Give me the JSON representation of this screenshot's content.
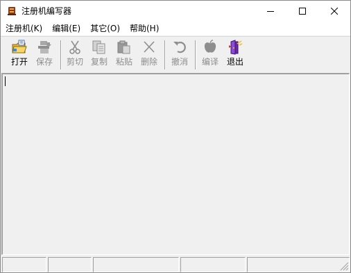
{
  "window": {
    "title": "注册机编写器"
  },
  "menu": [
    {
      "label": "注册机(K)"
    },
    {
      "label": "编辑(E)"
    },
    {
      "label": "其它(O)"
    },
    {
      "label": "帮助(H)"
    }
  ],
  "toolbar": {
    "open": {
      "label": "打开",
      "icon": "open-folder-icon",
      "enabled": true
    },
    "save": {
      "label": "保存",
      "icon": "save-icon",
      "enabled": false
    },
    "cut": {
      "label": "剪切",
      "icon": "scissors-icon",
      "enabled": false
    },
    "copy": {
      "label": "复制",
      "icon": "copy-icon",
      "enabled": false
    },
    "paste": {
      "label": "粘贴",
      "icon": "paste-icon",
      "enabled": false
    },
    "delete": {
      "label": "删除",
      "icon": "delete-x-icon",
      "enabled": false
    },
    "undo": {
      "label": "撤消",
      "icon": "undo-icon",
      "enabled": false
    },
    "compile": {
      "label": "编译",
      "icon": "compile-icon",
      "enabled": false
    },
    "exit": {
      "label": "退出",
      "icon": "exit-icon",
      "enabled": true
    }
  },
  "editor": {
    "content": ""
  },
  "statusbar": {
    "panels": [
      "",
      "",
      "",
      "",
      "",
      ""
    ]
  },
  "colors": {
    "disabled_text": "#8d8d8d",
    "window_bg": "#f0f0f0",
    "titlebar_bg": "#ffffff"
  }
}
